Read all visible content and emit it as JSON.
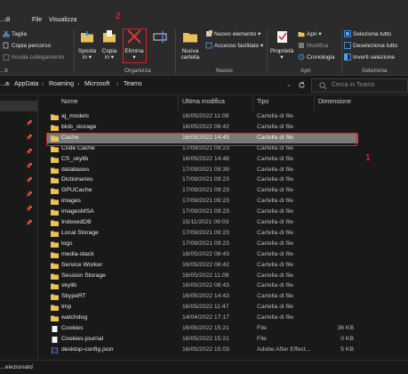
{
  "ribbon": {
    "tabs": [
      "...di",
      "File",
      "Visualizza"
    ],
    "step_labels": [
      "2",
      "1"
    ],
    "clipboard": {
      "items": [
        "Taglia",
        "Copia percorso",
        "Incolla collegamento"
      ],
      "group_label": "...ti"
    },
    "organize": {
      "sposta": [
        "Sposta",
        "in ▾"
      ],
      "copia": [
        "Copia",
        "in ▾"
      ],
      "elimina": [
        "Elimina",
        "▾"
      ],
      "rinomina": "Rinomina",
      "group_label": "Organizza"
    },
    "new": {
      "folder": [
        "Nuova",
        "cartella"
      ],
      "items": [
        "Nuovo elemento ▾",
        "Accesso facilitato ▾"
      ],
      "group_label": "Nuovo"
    },
    "open": {
      "proprieta": [
        "Proprietà",
        "▾"
      ],
      "items": [
        "Apri ▾",
        "Modifica",
        "Cronologia"
      ],
      "group_label": "Apri"
    },
    "select": {
      "items": [
        "Seleziona tutto",
        "Deseleziona tutto",
        "Inverti selezione"
      ],
      "group_label": "Seleziona"
    }
  },
  "address": {
    "crumbs": [
      "...a",
      "AppData",
      "Roaming",
      "Microsoft",
      "Teams"
    ],
    "search_placeholder": "Cerca in Teams"
  },
  "columns": [
    "Nome",
    "Ultima modifica",
    "Tipo",
    "Dimensione"
  ],
  "files": [
    {
      "name": "aj_models",
      "date": "16/05/2022 11:09",
      "type": "Cartella di file",
      "size": "",
      "kind": "folder"
    },
    {
      "name": "blob_storage",
      "date": "16/05/2022 08:42",
      "type": "Cartella di file",
      "size": "",
      "kind": "folder"
    },
    {
      "name": "Cache",
      "date": "16/05/2022 14:43",
      "type": "Cartella di file",
      "size": "",
      "kind": "folder",
      "selected": true
    },
    {
      "name": "Code Cache",
      "date": "17/09/2021 09:23",
      "type": "Cartella di file",
      "size": "",
      "kind": "folder"
    },
    {
      "name": "CS_skylib",
      "date": "16/05/2022 14:48",
      "type": "Cartella di file",
      "size": "",
      "kind": "folder"
    },
    {
      "name": "databases",
      "date": "17/09/2021 09:39",
      "type": "Cartella di file",
      "size": "",
      "kind": "folder"
    },
    {
      "name": "Dictionaries",
      "date": "17/09/2021 09:23",
      "type": "Cartella di file",
      "size": "",
      "kind": "folder"
    },
    {
      "name": "GPUCache",
      "date": "17/09/2021 09:23",
      "type": "Cartella di file",
      "size": "",
      "kind": "folder"
    },
    {
      "name": "images",
      "date": "17/09/2021 09:23",
      "type": "Cartella di file",
      "size": "",
      "kind": "folder"
    },
    {
      "name": "imagesMSA",
      "date": "17/09/2021 09:23",
      "type": "Cartella di file",
      "size": "",
      "kind": "folder"
    },
    {
      "name": "IndexedDB",
      "date": "15/11/2021 09:03",
      "type": "Cartella di file",
      "size": "",
      "kind": "folder"
    },
    {
      "name": "Local Storage",
      "date": "17/09/2021 09:23",
      "type": "Cartella di file",
      "size": "",
      "kind": "folder"
    },
    {
      "name": "logs",
      "date": "17/09/2021 09:23",
      "type": "Cartella di file",
      "size": "",
      "kind": "folder"
    },
    {
      "name": "media-stack",
      "date": "16/05/2022 08:43",
      "type": "Cartella di file",
      "size": "",
      "kind": "folder"
    },
    {
      "name": "Service Worker",
      "date": "16/05/2022 08:42",
      "type": "Cartella di file",
      "size": "",
      "kind": "folder"
    },
    {
      "name": "Session Storage",
      "date": "16/05/2022 11:09",
      "type": "Cartella di file",
      "size": "",
      "kind": "folder"
    },
    {
      "name": "skylib",
      "date": "16/05/2022 08:43",
      "type": "Cartella di file",
      "size": "",
      "kind": "folder"
    },
    {
      "name": "SkypeRT",
      "date": "16/05/2022 14:43",
      "type": "Cartella di file",
      "size": "",
      "kind": "folder"
    },
    {
      "name": "tmp",
      "date": "16/05/2022 11:47",
      "type": "Cartella di file",
      "size": "",
      "kind": "folder"
    },
    {
      "name": "watchdog",
      "date": "14/04/2022 17:17",
      "type": "Cartella di file",
      "size": "",
      "kind": "folder"
    },
    {
      "name": "Cookies",
      "date": "16/05/2022 15:21",
      "type": "File",
      "size": "36 KB",
      "kind": "file"
    },
    {
      "name": "Cookies-journal",
      "date": "16/05/2022 15:21",
      "type": "File",
      "size": "0 KB",
      "kind": "file"
    },
    {
      "name": "desktop-config.json",
      "date": "16/05/2022 15:03",
      "type": "Adobe After Effect...",
      "size": "5 KB",
      "kind": "json"
    }
  ],
  "status": {
    "text": "...elezionato"
  },
  "colors": {
    "selection": "#7a7a7a",
    "highlight": "#e02020",
    "folder": "#e8c15a",
    "ribbon": "#2b2b2b"
  }
}
